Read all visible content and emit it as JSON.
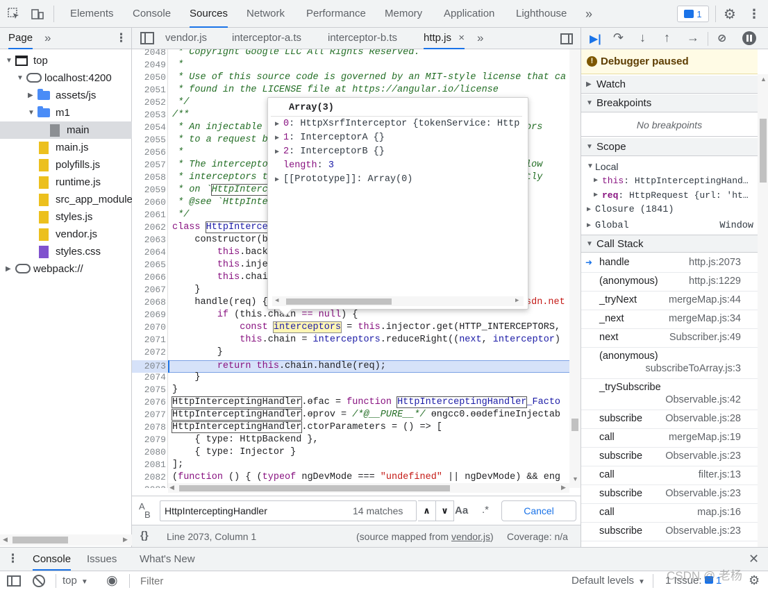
{
  "main_tabs": [
    "Elements",
    "Console",
    "Sources",
    "Network",
    "Performance",
    "Memory",
    "Application",
    "Lighthouse"
  ],
  "issues_count": "1",
  "nav": {
    "tab": "Page",
    "tree": [
      {
        "label": "top",
        "kind": "frame",
        "depth": 0,
        "expanded": true
      },
      {
        "label": "localhost:4200",
        "kind": "cloud",
        "depth": 1,
        "expanded": true
      },
      {
        "label": "assets/js",
        "kind": "folder",
        "depth": 2,
        "expanded": false
      },
      {
        "label": "m1",
        "kind": "folder",
        "depth": 2,
        "expanded": true
      },
      {
        "label": "main",
        "kind": "gray",
        "depth": 3,
        "selected": true
      },
      {
        "label": "main.js",
        "kind": "js",
        "depth": 2
      },
      {
        "label": "polyfills.js",
        "kind": "js",
        "depth": 2
      },
      {
        "label": "runtime.js",
        "kind": "js",
        "depth": 2
      },
      {
        "label": "src_app_modules",
        "kind": "js",
        "depth": 2
      },
      {
        "label": "styles.js",
        "kind": "js",
        "depth": 2
      },
      {
        "label": "vendor.js",
        "kind": "js",
        "depth": 2
      },
      {
        "label": "styles.css",
        "kind": "css",
        "depth": 2
      },
      {
        "label": "webpack://",
        "kind": "cloud",
        "depth": 0,
        "expanded": false
      }
    ]
  },
  "file_tabs": [
    "vendor.js",
    "interceptor-a.ts",
    "interceptor-b.ts",
    "http.js"
  ],
  "active_file_close": "×",
  "gutter": [
    "2048",
    "2049",
    "2050",
    "2051",
    "2052",
    "2053",
    "2054",
    "2055",
    "2056",
    "2057",
    "2058",
    "2059",
    "2060",
    "2061",
    "2062",
    "2063",
    "2064",
    "2065",
    "2066",
    "2067",
    "2068",
    "2069",
    "2070",
    "2071",
    "2072",
    "2073",
    "2074",
    "2075",
    "2076",
    "2077",
    "2078",
    "2079",
    "2080",
    "2081",
    "2082",
    "2083"
  ],
  "code": {
    "l2048": " * Copyright Google LLC All Rights Reserved.",
    "l2049": " *",
    "l2050": " * Use of this source code is governed by an MIT-style license that ca",
    "l2051": " * found in the LICENSE file at https://angular.io/license",
    "l2052": " */",
    "l2053": "/**",
    "l2054a": " * An injectable ",
    "l2054b": "ors",
    "l2055a": " * to a request b",
    "l2056": " *",
    "l2057a": " * The intercepto",
    "l2057b": "low",
    "l2058a": " * interceptors t",
    "l2058b": "tly",
    "l2059a": " * on `",
    "l2059b": "HttpInterc",
    "l2060a": " * @see `HttpInte",
    "l2061": " */",
    "l2062a": "class ",
    "l2062b": "HttpInterce",
    "l2063": "    constructor(b",
    "l2064a": "        ",
    "l2064b": "this",
    "l2064c": ".back",
    "l2065b": "this",
    "l2065c": ".inje",
    "l2066b": "this",
    "l2066c": ".chai",
    "l2067": "    }",
    "l2068a": "    handle(req) {",
    "l2068b": "sdn.net",
    "l2069a": "        ",
    "l2069b": "if",
    "l2069c": " (this.chain ",
    "l2069d": "== null",
    "l2069e": ") {",
    "l2070a": "            ",
    "l2070b": "const",
    "l2070c": " ",
    "l2070d": "interceptors",
    "l2070e": " = ",
    "l2070f": "this",
    "l2070g": ".injector.get(HTTP_INTERCEPTORS, ",
    "l2071a": "            ",
    "l2071b": "this",
    "l2071c": ".chain = ",
    "l2071d": "interceptors",
    "l2071e": ".reduceRight((",
    "l2071f": "next",
    "l2071g": ", ",
    "l2071h": "interceptor",
    "l2071i": ")",
    "l2072": "        }",
    "l2073a": "        ",
    "l2073b": "return",
    "l2073c": " ",
    "l2073d": "this",
    "l2073e": ".chain.handle(req);",
    "l2074": "    }",
    "l2075": "}",
    "l2076a": "HttpInterceptingHandler",
    "l2076b": ".ɵfac = ",
    "l2076c": "function",
    "l2076d": " ",
    "l2076e": "HttpInterceptingHandler",
    "l2076f": "_Facto",
    "l2077a": "HttpInterceptingHandler",
    "l2077b": ".ɵprov = ",
    "l2077c": "/*@__PURE__*/",
    "l2077d": " ɵngcc0.ɵɵdefineInjectab",
    "l2078a": "HttpInterceptingHandler",
    "l2078b": ".ctorParameters = () => [",
    "l2079": "    { type: HttpBackend },",
    "l2080": "    { type: Injector }",
    "l2081": "];",
    "l2082a": "(",
    "l2082b": "function",
    "l2082c": " () { (",
    "l2082d": "typeof",
    "l2082e": " ngDevMode === ",
    "l2082f": "\"undefined\"",
    "l2082g": " || ngDevMode) && eng"
  },
  "popover": {
    "title": "Array(3)",
    "items": [
      {
        "index": "0",
        "value": "HttpXsrfInterceptor {tokenService: Http"
      },
      {
        "index": "1",
        "value": "InterceptorA {}"
      },
      {
        "index": "2",
        "value": "InterceptorB {}"
      }
    ],
    "length_label": "length",
    "length_value": "3",
    "proto": "[[Prototype]]: Array(0)"
  },
  "search": {
    "value": "HttpInterceptingHandler",
    "matches": "14 matches",
    "case_label": "Aa",
    "regex_label": ".*",
    "cancel": "Cancel"
  },
  "status": {
    "braces": "{}",
    "position": "Line 2073, Column 1",
    "mapped_prefix": "(source mapped from ",
    "mapped_link": "vendor.js",
    "mapped_suffix": ")",
    "coverage": "Coverage: n/a"
  },
  "debugger": {
    "paused": "Debugger paused",
    "watch": "Watch",
    "breakpoints": "Breakpoints",
    "no_breakpoints": "No breakpoints",
    "scope": "Scope",
    "local": "Local",
    "this_key": "this",
    "this_val": ": HttpInterceptingHand…",
    "req_key": "req",
    "req_val": ": HttpRequest {url: 'ht…",
    "closure": "Closure (1841)",
    "global": "Global",
    "global_val": "Window",
    "call_stack": "Call Stack",
    "frames": [
      {
        "name": "handle",
        "loc": "http.js:2073",
        "current": true
      },
      {
        "name": "(anonymous)",
        "loc": "http.js:1229"
      },
      {
        "name": "_tryNext",
        "loc": "mergeMap.js:44"
      },
      {
        "name": "_next",
        "loc": "mergeMap.js:34"
      },
      {
        "name": "next",
        "loc": "Subscriber.js:49"
      },
      {
        "name": "(anonymous)",
        "loc": "subscribeToArray.js:3",
        "twoline": true
      },
      {
        "name": "_trySubscribe",
        "loc": "Observable.js:42",
        "twoline": true
      },
      {
        "name": "subscribe",
        "loc": "Observable.js:28"
      },
      {
        "name": "call",
        "loc": "mergeMap.js:19"
      },
      {
        "name": "subscribe",
        "loc": "Observable.js:23"
      },
      {
        "name": "call",
        "loc": "filter.js:13"
      },
      {
        "name": "subscribe",
        "loc": "Observable.js:23"
      },
      {
        "name": "call",
        "loc": "map.js:16"
      },
      {
        "name": "subscribe",
        "loc": "Observable.js:23"
      }
    ]
  },
  "drawer": {
    "tabs": [
      "Console",
      "Issues",
      "What's New"
    ],
    "context": "top",
    "filter_placeholder": "Filter",
    "levels": "Default levels",
    "issues": "1 Issue:",
    "issues_count": "1",
    "watermark": "CSDN @ 老杨"
  }
}
